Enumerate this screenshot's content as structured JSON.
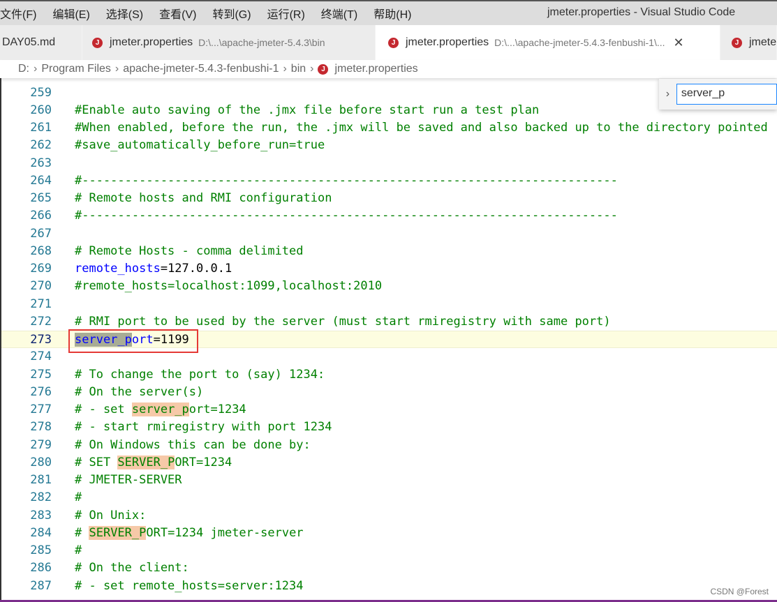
{
  "window": {
    "title": "jmeter.properties - Visual Studio Code"
  },
  "menu": [
    "文件(F)",
    "编辑(E)",
    "选择(S)",
    "查看(V)",
    "转到(G)",
    "运行(R)",
    "终端(T)",
    "帮助(H)"
  ],
  "tabs": [
    {
      "label": "DAY05.md",
      "desc": "",
      "icon": "",
      "active": false
    },
    {
      "label": "jmeter.properties",
      "desc": "D:\\...\\apache-jmeter-5.4.3\\bin",
      "icon": "java-properties-icon",
      "active": false
    },
    {
      "label": "jmeter.properties",
      "desc": "D:\\...\\apache-jmeter-5.4.3-fenbushi-1\\...",
      "icon": "java-properties-icon",
      "active": true
    },
    {
      "label": "jmeter.properties",
      "desc": "",
      "icon": "java-properties-icon",
      "active": false
    }
  ],
  "tab_icon_letter": "J",
  "breadcrumb": [
    "D:",
    "Program Files",
    "apache-jmeter-5.4.3-fenbushi-1",
    "bin",
    "jmeter.properties"
  ],
  "find": {
    "value": "server_p"
  },
  "colors": {
    "comment": "#008000",
    "key": "#0000ff",
    "line_number": "#237893",
    "find_match": "#f6c9a8",
    "selection": "#a8ac95",
    "highlight_box": "#e53935"
  },
  "current_line": 273,
  "lines": [
    {
      "n": "259",
      "tokens": []
    },
    {
      "n": "260",
      "tokens": [
        {
          "t": "#Enable auto saving of the .jmx file before start run a test plan",
          "c": "comment"
        }
      ]
    },
    {
      "n": "261",
      "tokens": [
        {
          "t": "#When enabled, before the run, the .jmx will be saved and also backed up to the directory pointed",
          "c": "comment"
        }
      ]
    },
    {
      "n": "262",
      "tokens": [
        {
          "t": "#save_automatically_before_run=true",
          "c": "comment"
        }
      ]
    },
    {
      "n": "263",
      "tokens": []
    },
    {
      "n": "264",
      "tokens": [
        {
          "t": "#---------------------------------------------------------------------------",
          "c": "comment"
        }
      ]
    },
    {
      "n": "265",
      "tokens": [
        {
          "t": "# Remote hosts and RMI configuration",
          "c": "comment"
        }
      ]
    },
    {
      "n": "266",
      "tokens": [
        {
          "t": "#---------------------------------------------------------------------------",
          "c": "comment"
        }
      ]
    },
    {
      "n": "267",
      "tokens": []
    },
    {
      "n": "268",
      "tokens": [
        {
          "t": "# Remote Hosts - comma delimited",
          "c": "comment"
        }
      ]
    },
    {
      "n": "269",
      "tokens": [
        {
          "t": "remote_hosts",
          "c": "key"
        },
        {
          "t": "=127.0.0.1",
          "c": "val"
        }
      ]
    },
    {
      "n": "270",
      "tokens": [
        {
          "t": "#remote_hosts=localhost:1099,localhost:2010",
          "c": "comment"
        }
      ]
    },
    {
      "n": "271",
      "tokens": []
    },
    {
      "n": "272",
      "tokens": [
        {
          "t": "# RMI port to be used by the server (must start rmiregistry with same port)",
          "c": "comment"
        }
      ]
    },
    {
      "n": "273",
      "tokens": [
        {
          "t": "server_p",
          "c": "key sel"
        },
        {
          "t": "ort",
          "c": "key"
        },
        {
          "t": "=1199",
          "c": "val"
        }
      ]
    },
    {
      "n": "274",
      "tokens": []
    },
    {
      "n": "275",
      "tokens": [
        {
          "t": "# To change the port to (say) 1234:",
          "c": "comment"
        }
      ]
    },
    {
      "n": "276",
      "tokens": [
        {
          "t": "# On the server(s)",
          "c": "comment"
        }
      ]
    },
    {
      "n": "277",
      "tokens": [
        {
          "t": "# - set ",
          "c": "comment"
        },
        {
          "t": "server_p",
          "c": "comment match"
        },
        {
          "t": "ort=1234",
          "c": "comment"
        }
      ]
    },
    {
      "n": "278",
      "tokens": [
        {
          "t": "# - start rmiregistry with port 1234",
          "c": "comment"
        }
      ]
    },
    {
      "n": "279",
      "tokens": [
        {
          "t": "# On Windows this can be done by:",
          "c": "comment"
        }
      ]
    },
    {
      "n": "280",
      "tokens": [
        {
          "t": "# SET ",
          "c": "comment"
        },
        {
          "t": "SERVER_P",
          "c": "comment match"
        },
        {
          "t": "ORT=1234",
          "c": "comment"
        }
      ]
    },
    {
      "n": "281",
      "tokens": [
        {
          "t": "# JMETER-SERVER",
          "c": "comment"
        }
      ]
    },
    {
      "n": "282",
      "tokens": [
        {
          "t": "#",
          "c": "comment"
        }
      ]
    },
    {
      "n": "283",
      "tokens": [
        {
          "t": "# On Unix:",
          "c": "comment"
        }
      ]
    },
    {
      "n": "284",
      "tokens": [
        {
          "t": "# ",
          "c": "comment"
        },
        {
          "t": "SERVER_P",
          "c": "comment match"
        },
        {
          "t": "ORT=1234 jmeter-server",
          "c": "comment"
        }
      ]
    },
    {
      "n": "285",
      "tokens": [
        {
          "t": "#",
          "c": "comment"
        }
      ]
    },
    {
      "n": "286",
      "tokens": [
        {
          "t": "# On the client:",
          "c": "comment"
        }
      ]
    },
    {
      "n": "287",
      "tokens": [
        {
          "t": "# - set remote_hosts=server:1234",
          "c": "comment"
        }
      ]
    }
  ],
  "watermark": "CSDN @Forest"
}
